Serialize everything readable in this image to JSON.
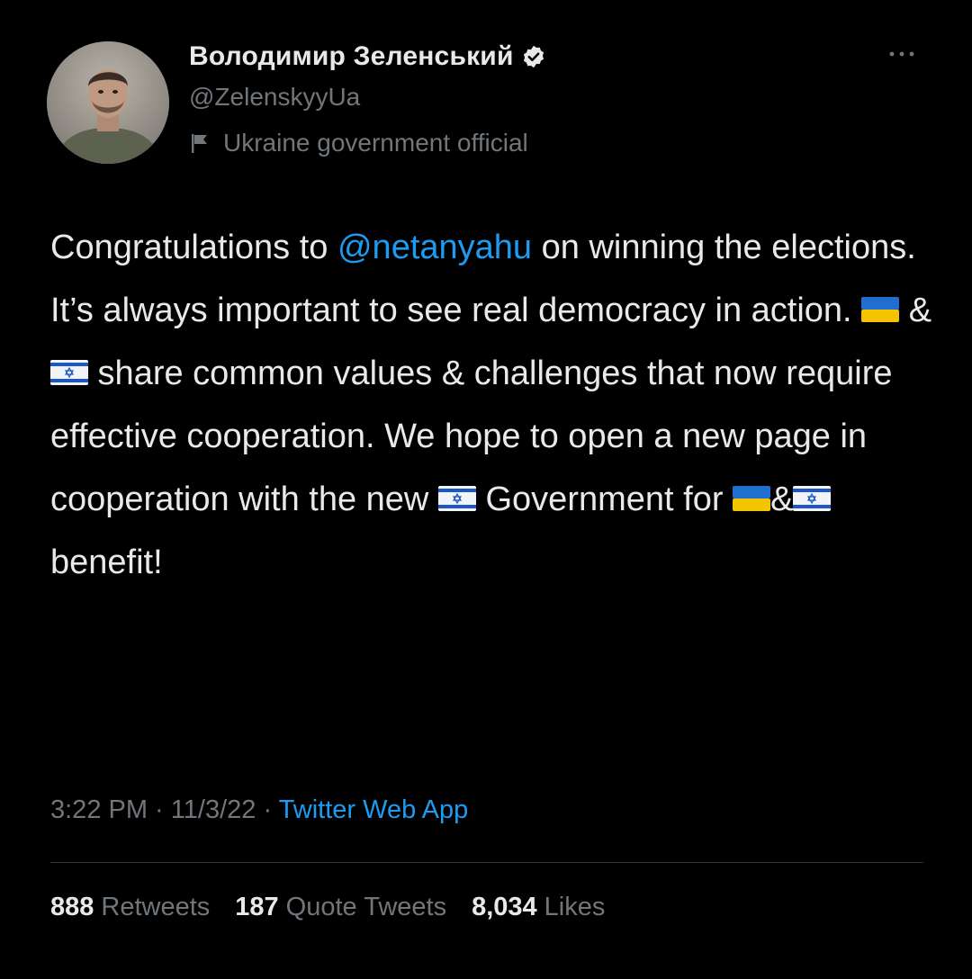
{
  "author": {
    "display_name": "Володимир Зеленський",
    "handle": "@ZelenskyyUa",
    "affiliation": "Ukraine government official",
    "verified_icon": "verified-badge-icon",
    "affiliation_icon": "flag-icon"
  },
  "tweet": {
    "segments": {
      "s1": "Congratulations to ",
      "mention": "@netanyahu",
      "s2": " on winning the elections. It’s always important to see real democracy in action. ",
      "s3": " & ",
      "s4": " share common values & challenges that now require effective cooperation. We hope to open a new page in cooperation with the new ",
      "s5": " Government for ",
      "s6": "&",
      "s7": "  benefit!"
    },
    "emoji": {
      "ukraine_flag": "🇺🇦",
      "israel_flag": "🇮🇱"
    }
  },
  "meta": {
    "time": "3:22 PM",
    "separator": " · ",
    "date": "11/3/22",
    "source": "Twitter Web App"
  },
  "stats": {
    "retweets_count": "888",
    "retweets_label": "Retweets",
    "quotes_count": "187",
    "quotes_label": "Quote Tweets",
    "likes_count": "8,034",
    "likes_label": "Likes"
  },
  "colors": {
    "background": "#000000",
    "text": "#e7e9ea",
    "secondary": "#71767b",
    "accent": "#1d9bf0",
    "divider": "#2f3336"
  }
}
